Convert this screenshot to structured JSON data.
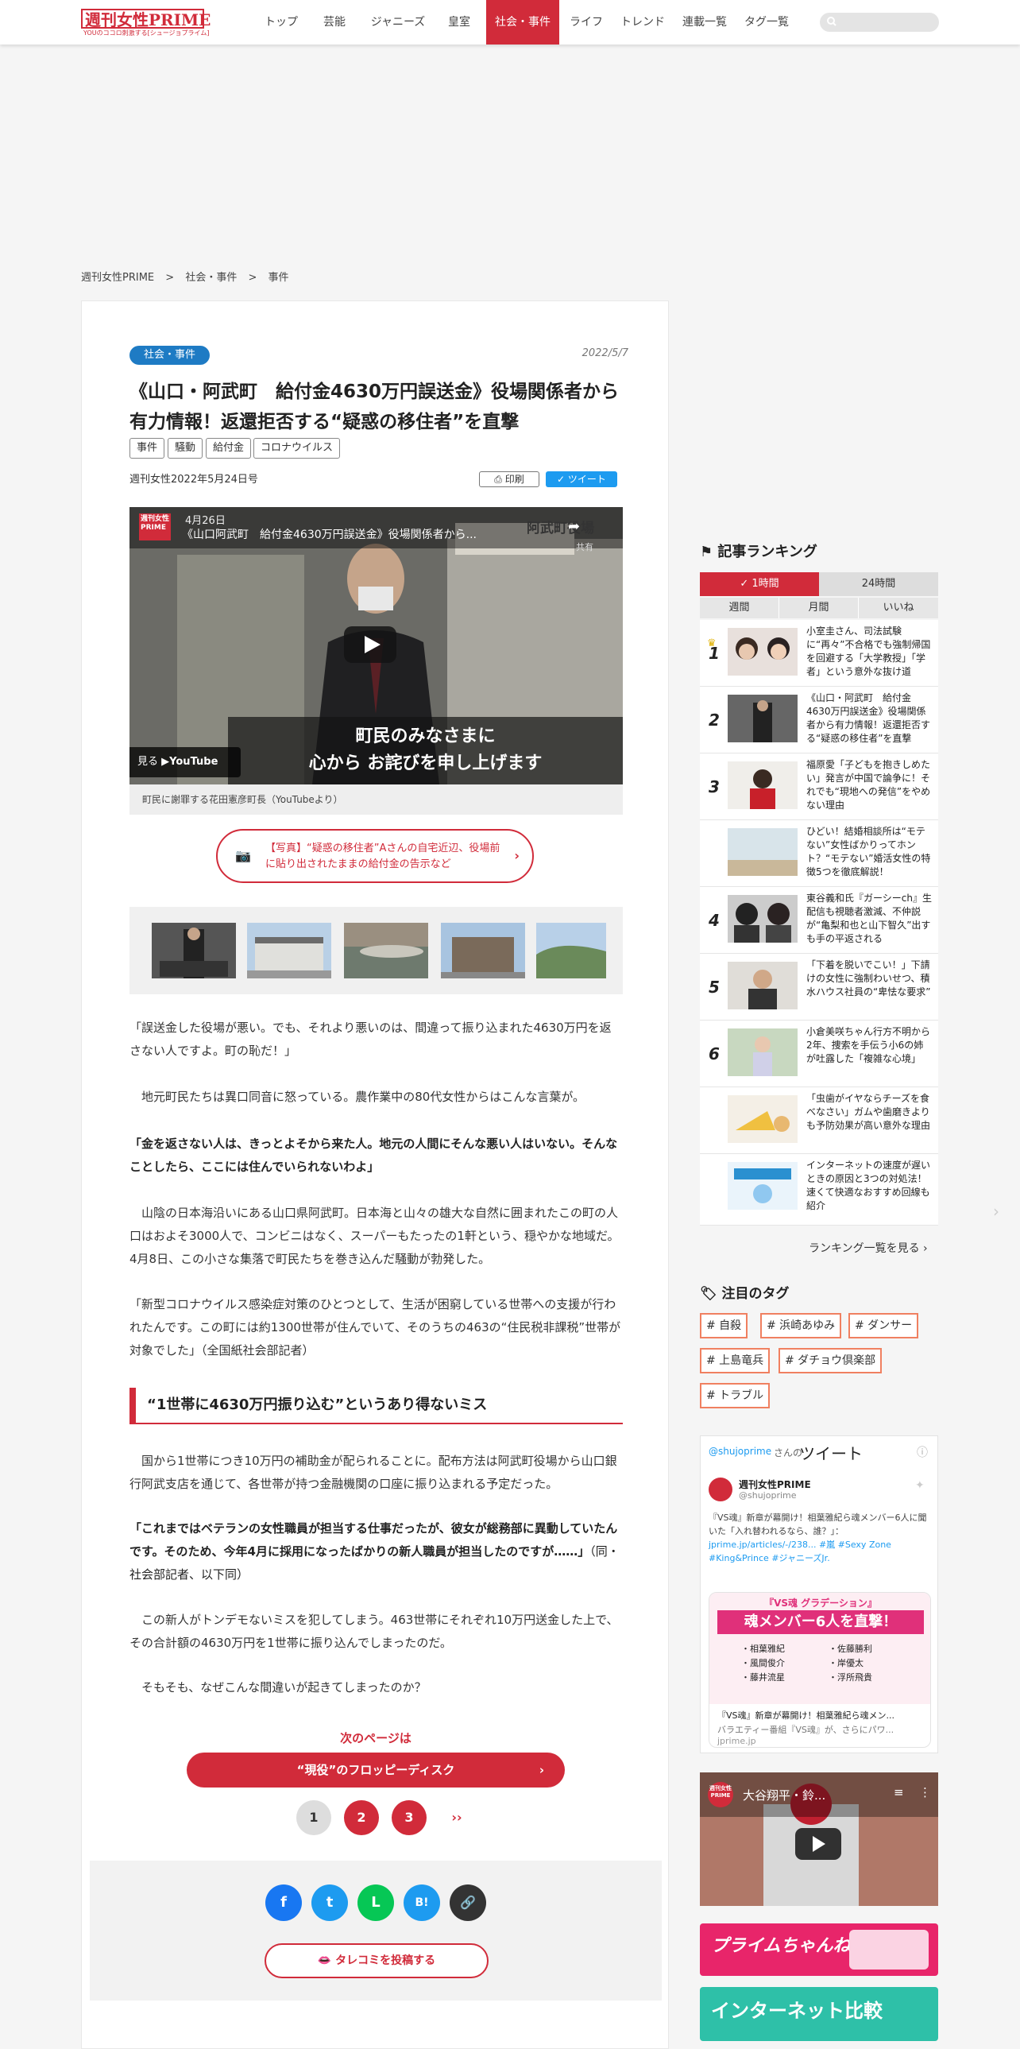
{
  "header": {
    "logo": "週刊女性PRIME",
    "logo_sub": "YOUのココロ刺激する[シュージョプライム]",
    "nav": [
      "トップ",
      "芸能",
      "ジャニーズ",
      "皇室",
      "社会・事件",
      "ライフ",
      "トレンド",
      "連載一覧",
      "タグ一覧"
    ]
  },
  "breadcrumb": [
    "週刊女性PRIME",
    ">",
    "社会・事件",
    ">",
    "事件"
  ],
  "article": {
    "category": "社会・事件",
    "date": "2022/5/7",
    "title": "《山口・阿武町　給付金4630万円誤送金》役場関係者から有力情報！返還拒否する“疑惑の移住者”を直撃",
    "tags": [
      "事件",
      "騒動",
      "給付金",
      "コロナウイルス"
    ],
    "publication": "週刊女性2022年5月24日号",
    "print_label": "印刷",
    "tweet_label": "ツイート",
    "video": {
      "title": "《山口阿武町　給付金4630万円誤送金》役場関係者から...",
      "date_overlay": "4月26日",
      "share": "共有",
      "watch": "見る",
      "youtube": "YouTube",
      "sign": "阿武町役場",
      "subtitle1": "町民のみなさまに",
      "subtitle2": "心から お詫びを申し上げます",
      "logo": "週刊女性PRIME"
    },
    "video_caption": "町民に謝罪する花田憲彦町長（YouTubeより）",
    "photo_link": "【写真】“疑惑の移住者”Aさんの自宅近辺、役場前に貼り出されたままの給付金の告示など",
    "paragraphs": [
      "「誤送金した役場が悪い。でも、それより悪いのは、間違って振り込まれた4630万円を返さない人ですよ。町の恥だ！」",
      "　地元町民たちは異口同音に怒っている。農作業中の80代女性からはこんな言葉が。",
      "「金を返さない人は、きっとよそから来た人。地元の人間にそんな悪い人はいない。そんなことしたら、ここには住んでいられないわよ」",
      "　山陰の日本海沿いにある山口県阿武町。日本海と山々の雄大な自然に囲まれたこの町の人口はおよそ3000人で、コンビニはなく、スーパーもたったの1軒という、穏やかな地域だ。4月8日、この小さな集落で町民たちを巻き込んだ騒動が勃発した。",
      "「新型コロナウイルス感染症対策のひとつとして、生活が困窮している世帯への支援が行われたんです。この町には約1300世帯が住んでいて、そのうちの463の“住民税非課税”世帯が対象でした」（全国紙社会部記者）"
    ],
    "heading": "“1世帯に4630万円振り込む”というあり得ないミス",
    "paragraphs2": [
      "　国から1世帯につき10万円の補助金が配られることに。配布方法は阿武町役場から山口銀行阿武支店を通じて、各世帯が持つ金融機関の口座に振り込まれる予定だった。",
      "「これまではベテランの女性職員が担当する仕事だったが、彼女が総務部に異動していたんです。そのため、今年4月に採用になったばかりの新人職員が担当したのですが……」",
      "（同・社会部記者、以下同）",
      "　この新人がトンデモないミスを犯してしまう。463世帯にそれぞれ10万円送金した上で、その合計額の4630万円を1世帯に振り込んでしまったのだ。",
      "　そもそも、なぜこんな間違いが起きてしまったのか？"
    ],
    "next_label": "次のページは",
    "next_button": "“現役”のフロッピーディスク",
    "pages": [
      "1",
      "2",
      "3"
    ],
    "pages_next": "››",
    "share": [
      "f",
      "t",
      "L",
      "B!",
      "🔗"
    ],
    "tarekomi": "タレコミを投稿する"
  },
  "ranking": {
    "title": "記事ランキング",
    "tabs": [
      "1時間",
      "24時間"
    ],
    "subtabs": [
      "週間",
      "月間",
      "いいね"
    ],
    "items": [
      {
        "n": "1",
        "t": "小室圭さん、司法試験に“再々”不合格でも強制帰国を回避する「大学教授」「学者」という意外な抜け道"
      },
      {
        "n": "2",
        "t": "《山口・阿武町　給付金4630万円誤送金》役場関係者から有力情報！返還拒否する“疑惑の移住者”を直撃"
      },
      {
        "n": "3",
        "t": "福原愛「子どもを抱きしめたい」発言が中国で論争に！それでも“現地への発信”をやめない理由"
      },
      {
        "n": "",
        "t": "ひどい！結婚相談所は“モテない”女性ばかりってホント？“モテない”婚活女性の特徴5つを徹底解説！"
      },
      {
        "n": "4",
        "t": "東谷義和氏『ガーシーch』生配信も視聴者激減、不仲説が“亀梨和也と山下智久”出すも手の平返される"
      },
      {
        "n": "5",
        "t": "「下着を脱いでこい！」下請けの女性に強制わいせつ、積水ハウス社員の“卑怯な要求”"
      },
      {
        "n": "6",
        "t": "小倉美咲ちゃん行方不明から2年、捜索を手伝う小6の姉が吐露した「複雑な心境」"
      },
      {
        "n": "",
        "t": "「虫歯がイヤならチーズを食べなさい」ガムや歯磨きよりも予防効果が高い意外な理由"
      },
      {
        "n": "",
        "t": "インターネットの速度が遅いときの原因と3つの対処法！速くて快適なおすすめ回線も紹介"
      }
    ],
    "more": "ランキング一覧を見る"
  },
  "tags_section": {
    "title": "注目のタグ",
    "tags": [
      "# 自殺",
      "# 浜崎あゆみ",
      "# ダンサー",
      "# 上島竜兵",
      "# ダチョウ倶楽部",
      "# トラブル"
    ]
  },
  "twitter": {
    "handle_line": "@shujoprimeさんのツイート",
    "handle": "@shujoprime",
    "of": "さんの",
    "tweet_word": "ツイート",
    "account": "週刊女性PRIME",
    "body": "『VS魂』新章が幕開け！相葉雅紀ら魂メンバー6人に聞いた「入れ替われるなら、誰？」：",
    "link": "jprime.jp/articles/-/238... #嵐 #Sexy Zone #King&Prince #ジャニーズJr.",
    "card_title": "『VS魂』新章が幕開け！相葉雅紀ら魂メン...",
    "card_desc": "バラエティー番組『VS魂』が、さらにパワ...",
    "card_domain": "jprime.jp",
    "card_img_head": "『VS魂 グラデーション』",
    "card_img_main": "魂メンバー6人を直撃！",
    "members": [
      "相葉雅紀",
      "佐藤勝利",
      "風間俊介",
      "岸優太",
      "藤井流星",
      "浮所飛貴"
    ]
  },
  "youtube2": {
    "title": "大谷翔平・鈴...",
    "logo": "週刊女性PRIME"
  },
  "banners": [
    "プライムちゃんねる",
    "インターネット比較"
  ],
  "colors": {
    "brand": "#d12b3a",
    "category": "#1e7bc4",
    "twitter": "#1d9bf0"
  }
}
